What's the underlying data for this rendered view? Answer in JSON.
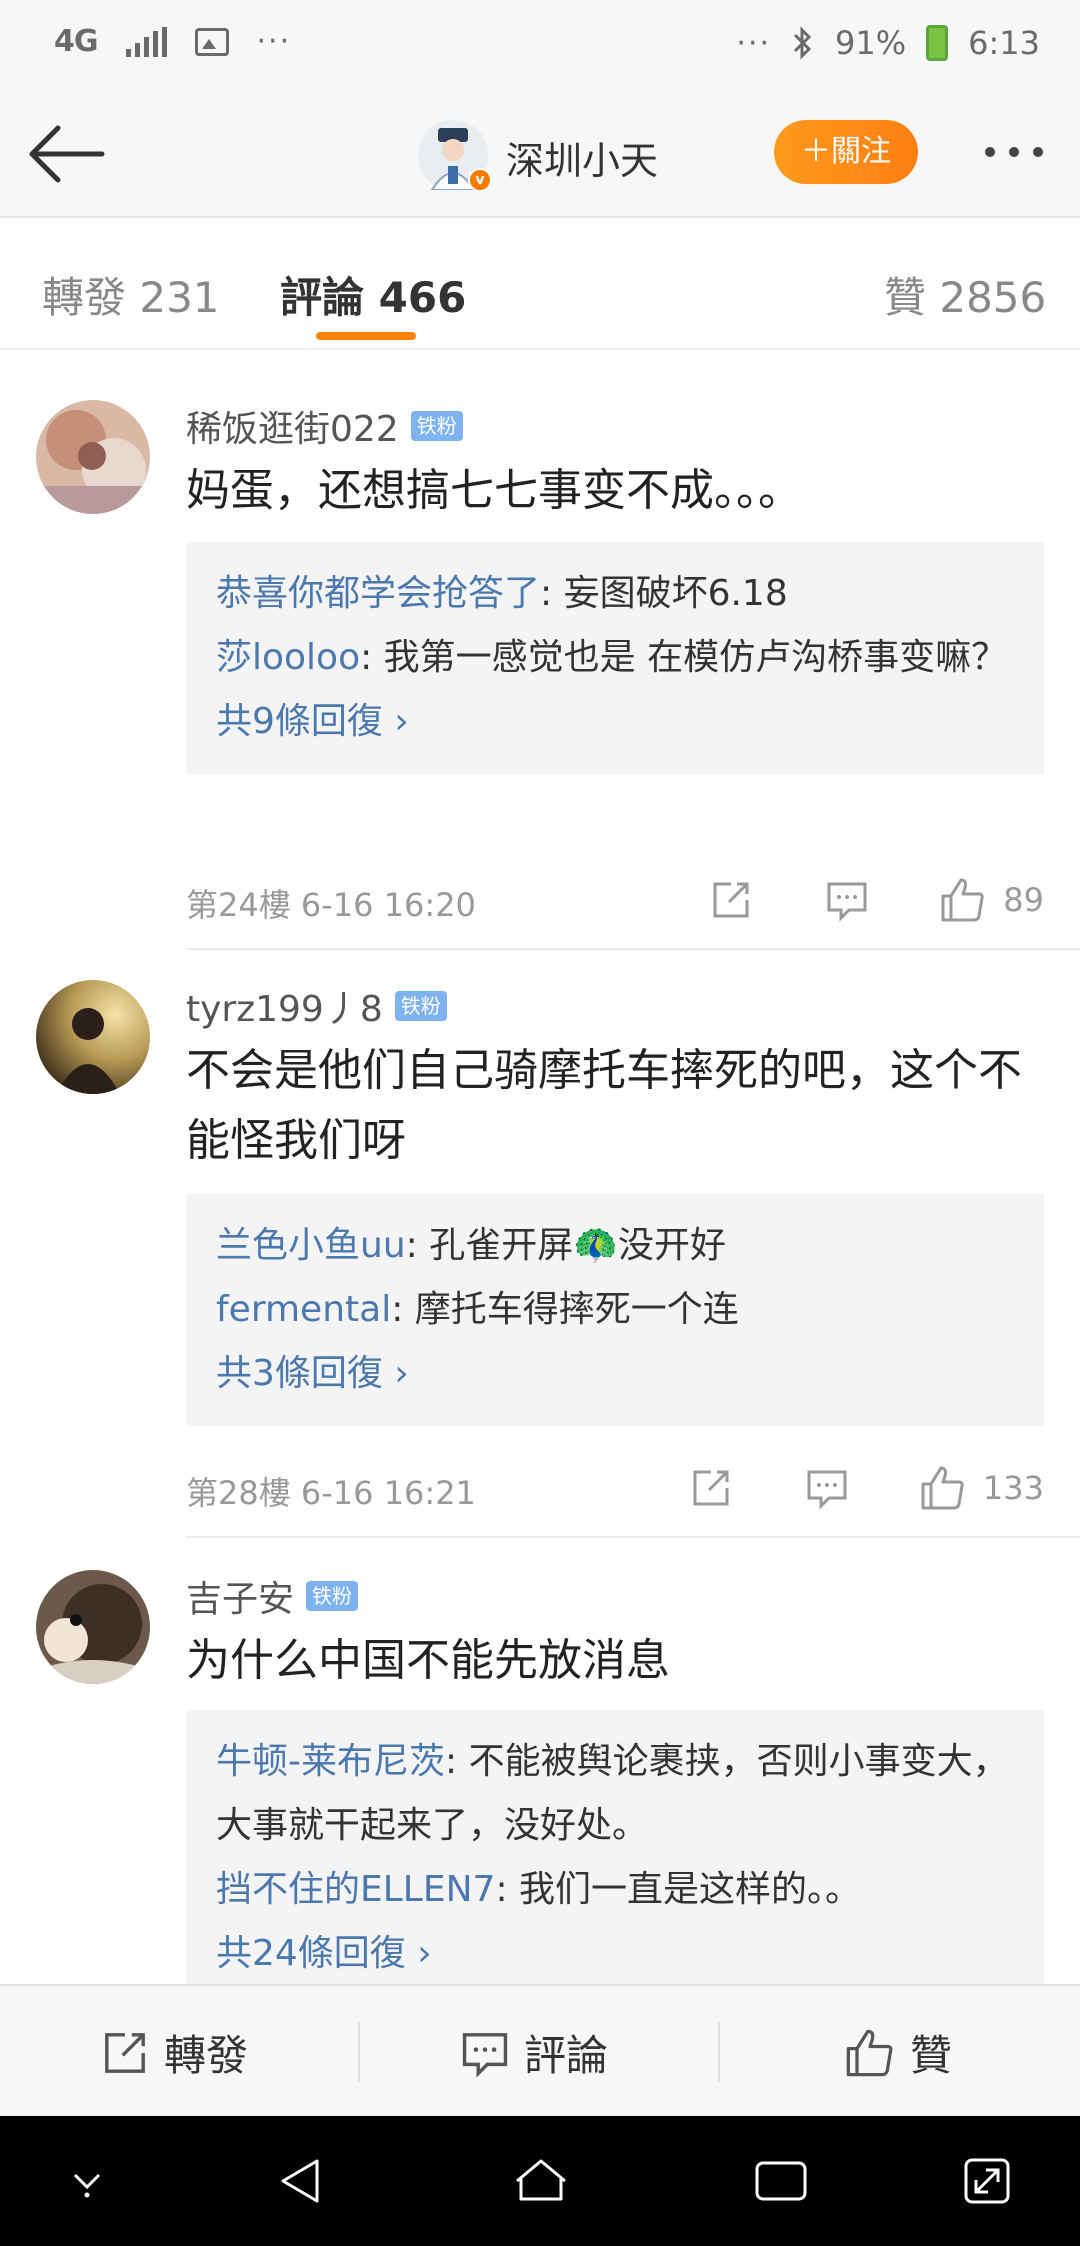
{
  "status_bar": {
    "network": "4G",
    "overflow": "···",
    "overflow_right": "···",
    "battery": "91%",
    "time": "6:13"
  },
  "header": {
    "title": "深圳小天",
    "follow_label": "＋關注"
  },
  "tabs": {
    "repost": "轉發 231",
    "comments": "評論 466",
    "likes": "贊 2856"
  },
  "comments": [
    {
      "username": "稀饭逛街022",
      "badge": "铁粉",
      "text": "妈蛋，还想搞七七事变不成。。。",
      "replies": [
        {
          "name": "恭喜你都学会抢答了",
          "text": ": 妄图破坏6.18"
        },
        {
          "name": "莎looloo",
          "text": ": 我第一感觉也是  在模仿卢沟桥事变嘛？"
        }
      ],
      "more": "共9條回復 ›",
      "floor": "第24樓  6-16 16:20",
      "likes": "89"
    },
    {
      "username": "tyrz199丿8",
      "badge": "铁粉",
      "text": "不会是他们自己骑摩托车摔死的吧，这个不能怪我们呀",
      "replies": [
        {
          "name": "兰色小鱼uu",
          "text": ": 孔雀开屏🦚没开好"
        },
        {
          "name": "fermental",
          "text": ": 摩托车得摔死一个连"
        }
      ],
      "more": "共3條回復 ›",
      "floor": "第28樓  6-16 16:21",
      "likes": "133"
    },
    {
      "username": "吉子安",
      "badge": "铁粉",
      "text": "为什么中国不能先放消息",
      "replies": [
        {
          "name": "牛顿-莱布尼茨",
          "text": ": 不能被舆论裹挟，否则小事变大，大事就干起来了，没好处。"
        },
        {
          "name": "挡不住的ELLEN7",
          "text": ": 我们一直是这样的。。"
        }
      ],
      "more": "共24條回復 ›"
    }
  ],
  "bottom_bar": {
    "repost": "轉發",
    "comment": "評論",
    "like": "贊"
  },
  "colors": {
    "accent": "#ff8200",
    "link": "#4b78ad",
    "badge": "#7fb3f0"
  }
}
